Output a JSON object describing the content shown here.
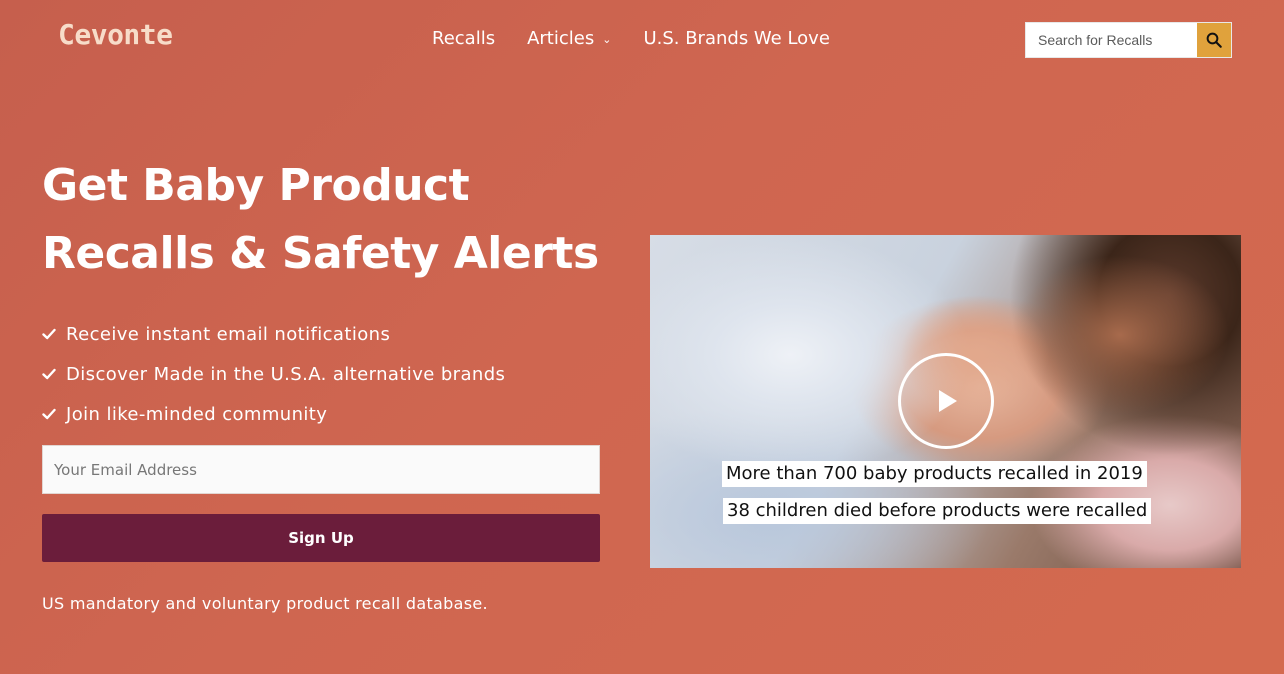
{
  "brand": {
    "logo": "Cevonte"
  },
  "nav": {
    "items": [
      {
        "label": "Recalls"
      },
      {
        "label": "Articles",
        "has_dropdown": true
      },
      {
        "label": "U.S. Brands We Love"
      }
    ]
  },
  "search": {
    "placeholder": "Search for Recalls",
    "icon": "search-icon",
    "button_color": "#e0a23c"
  },
  "hero": {
    "title_line1": "Get Baby Product",
    "title_line2": "Recalls & Safety Alerts",
    "benefits": [
      "Receive instant email notifications",
      "Discover Made in the U.S.A. alternative brands",
      "Join like-minded community"
    ],
    "email_placeholder": "Your Email Address",
    "signup_label": "Sign Up",
    "tagline": "US mandatory and voluntary product recall database."
  },
  "video": {
    "caption1": "More than 700 baby products recalled in 2019",
    "caption2": "38 children died before products were recalled",
    "icon": "play-icon"
  },
  "colors": {
    "background": "#cf6650",
    "signup_button": "#6b1d3b",
    "logo": "#f7dcc9"
  }
}
